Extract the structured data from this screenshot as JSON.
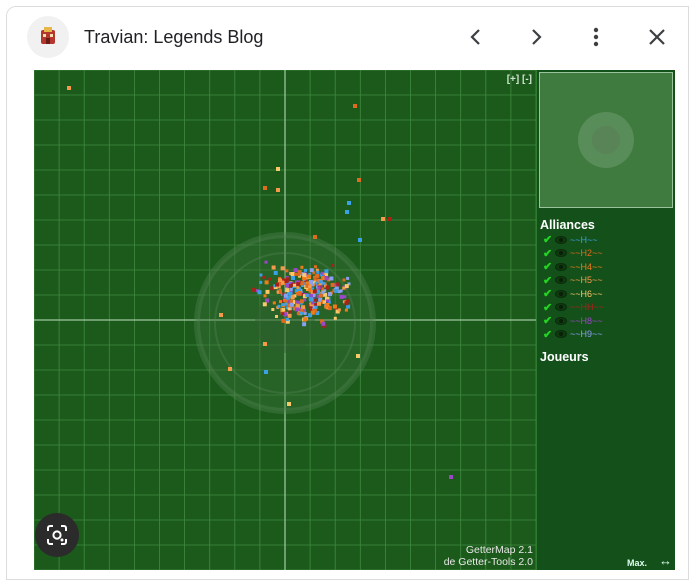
{
  "header": {
    "title": "Travian: Legends Blog",
    "icons": [
      "travian-favicon-icon",
      "chevron-left-icon",
      "chevron-right-icon",
      "more-vert-icon",
      "close-icon"
    ]
  },
  "map": {
    "zoom_in": "[+]",
    "zoom_out": "[-]",
    "credit_line1": "GetterMap 2.1",
    "credit_line2": "de Getter-Tools 2.0",
    "background_color": "#1c5a1c"
  },
  "sidebar": {
    "alliances_title": "Alliances",
    "players_title": "Joueurs",
    "alliances": [
      {
        "name": "~~H~~",
        "color": "#3aa0e8"
      },
      {
        "name": "~~H2~~",
        "color": "#e06a1f"
      },
      {
        "name": "~~H4~~",
        "color": "#f07c18"
      },
      {
        "name": "~~H5~~",
        "color": "#f59a4a"
      },
      {
        "name": "~~H6~~",
        "color": "#f7c96a"
      },
      {
        "name": "~~HH~~",
        "color": "#a8221a"
      },
      {
        "name": "~~H8~~",
        "color": "#9c46c8"
      },
      {
        "name": "~~H9~~",
        "color": "#8aa0f0"
      }
    ],
    "max_label": "Max.",
    "expand_arrow": "↔"
  },
  "lens_icon": "google-lens-icon"
}
